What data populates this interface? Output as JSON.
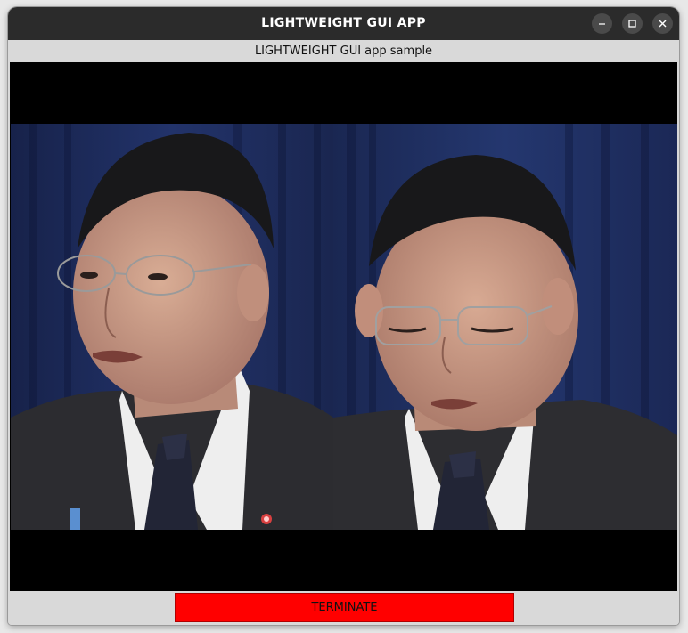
{
  "window": {
    "title": "LIGHTWEIGHT GUI APP",
    "controls": [
      "minimize-icon",
      "maximize-icon",
      "close-icon"
    ]
  },
  "header": {
    "subtitle": "LIGHTWEIGHT GUI app sample"
  },
  "video": {
    "frames": [
      {
        "description_icon": "speaker-frame-left"
      },
      {
        "description_icon": "speaker-frame-right"
      }
    ],
    "colors": {
      "background": "#000000",
      "curtain": "#1c2a55",
      "suit": "#2a2a2e",
      "skin": "#c89a82"
    }
  },
  "footer": {
    "terminate_label": "TERMINATE",
    "terminate_color": "#ff0000"
  }
}
